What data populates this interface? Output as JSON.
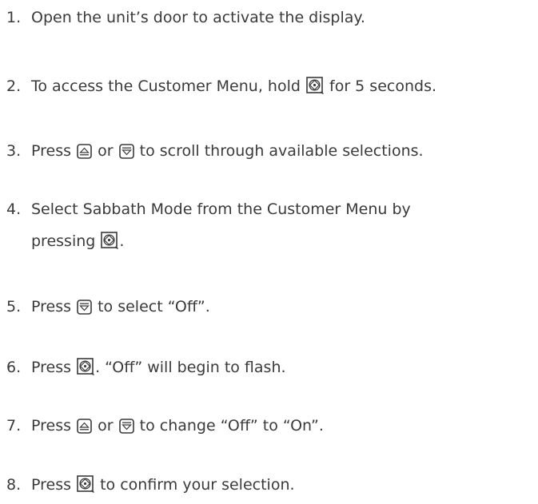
{
  "steps": [
    {
      "number": "1.",
      "text": "Open the unit’s door to activate the display."
    },
    {
      "number": "2.",
      "text_before": "To access the Customer Menu, hold",
      "icon": "enter-button-icon",
      "text_after": "for 5 seconds."
    },
    {
      "number": "3.",
      "text_1": "Press",
      "icon_1": "up-arrow-button-icon",
      "text_2": "or",
      "icon_2": "down-arrow-button-icon",
      "text_3": "to scroll through available selections."
    },
    {
      "number": "4.",
      "line1": "Select Sabbath Mode from the Customer Menu by",
      "line2_before": "pressing",
      "icon": "enter-button-icon",
      "line2_after": "."
    },
    {
      "number": "5.",
      "text_before": "Press",
      "icon": "down-arrow-button-icon",
      "text_after": "to select “Off”."
    },
    {
      "number": "6.",
      "text_before": "Press",
      "icon": "enter-button-icon",
      "text_after": ". “Off” will begin to flash."
    },
    {
      "number": "7.",
      "text_1": "Press",
      "icon_1": "up-arrow-button-icon",
      "text_2": "or",
      "icon_2": "down-arrow-button-icon",
      "text_3": "to change “Off” to “On”."
    },
    {
      "number": "8.",
      "text_before": "Press",
      "icon": "enter-button-icon",
      "text_after": "to confirm your selection."
    }
  ]
}
